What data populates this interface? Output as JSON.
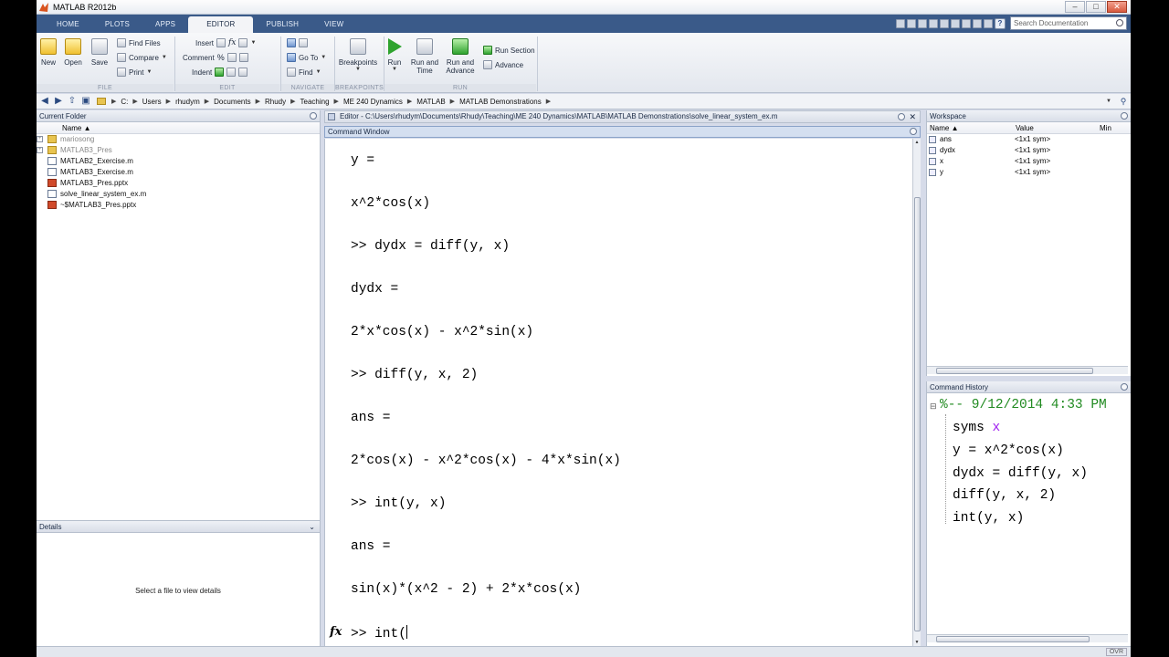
{
  "window": {
    "title": "MATLAB R2012b"
  },
  "tabs": [
    "HOME",
    "PLOTS",
    "APPS",
    "EDITOR",
    "PUBLISH",
    "VIEW"
  ],
  "active_tab": "EDITOR",
  "search": {
    "placeholder": "Search Documentation"
  },
  "ribbon": {
    "file": {
      "new": "New",
      "open": "Open",
      "save": "Save",
      "find_files": "Find Files",
      "compare": "Compare",
      "print": "Print",
      "group": "FILE"
    },
    "edit": {
      "insert": "Insert",
      "comment": "Comment",
      "indent": "Indent",
      "group": "EDIT"
    },
    "navigate": {
      "goto": "Go To",
      "find": "Find",
      "group": "NAVIGATE"
    },
    "breakpoints": {
      "label": "Breakpoints",
      "group": "BREAKPOINTS"
    },
    "run": {
      "run": "Run",
      "run_and_time_1": "Run and",
      "run_and_time_2": "Time",
      "run_and_advance_1": "Run and",
      "run_and_advance_2": "Advance",
      "run_section": "Run Section",
      "advance": "Advance",
      "group": "RUN"
    }
  },
  "address": {
    "crumbs": [
      "C:",
      "Users",
      "rhudym",
      "Documents",
      "Rhudy",
      "Teaching",
      "ME 240 Dynamics",
      "MATLAB",
      "MATLAB Demonstrations"
    ]
  },
  "current_folder": {
    "title": "Current Folder",
    "column": "Name ▲",
    "items": [
      {
        "name": "mariosong",
        "kind": "folder"
      },
      {
        "name": "MATLAB3_Pres",
        "kind": "folder"
      },
      {
        "name": "MATLAB2_Exercise.m",
        "kind": "m"
      },
      {
        "name": "MATLAB3_Exercise.m",
        "kind": "m"
      },
      {
        "name": "MATLAB3_Pres.pptx",
        "kind": "ppt"
      },
      {
        "name": "solve_linear_system_ex.m",
        "kind": "m"
      },
      {
        "name": "~$MATLAB3_Pres.pptx",
        "kind": "ppt"
      }
    ]
  },
  "details": {
    "title": "Details",
    "message": "Select a file to view details"
  },
  "editor": {
    "path": "Editor - C:\\Users\\rhudym\\Documents\\Rhudy\\Teaching\\ME 240 Dynamics\\MATLAB\\MATLAB Demonstrations\\solve_linear_system_ex.m"
  },
  "command_window": {
    "title": "Command Window",
    "lines": [
      "y =",
      "x^2*cos(x)",
      ">> dydx = diff(y, x)",
      "dydx =",
      "2*x*cos(x) - x^2*sin(x)",
      ">> diff(y, x, 2)",
      "ans =",
      "2*cos(x) - x^2*cos(x) - 4*x*sin(x)",
      ">> int(y, x)",
      "ans =",
      "sin(x)*(x^2 - 2) + 2*x*cos(x)"
    ],
    "prompt_input": ">> int(",
    "fx": "fx"
  },
  "workspace": {
    "title": "Workspace",
    "columns": [
      "Name ▲",
      "Value",
      "Min"
    ],
    "rows": [
      {
        "name": "ans",
        "value": "<1x1 sym>"
      },
      {
        "name": "dydx",
        "value": "<1x1 sym>"
      },
      {
        "name": "x",
        "value": "<1x1 sym>"
      },
      {
        "name": "y",
        "value": "<1x1 sym>"
      }
    ]
  },
  "command_history": {
    "title": "Command History",
    "session": "%-- 9/12/2014 4:33 PM",
    "cmd_syms": "syms",
    "cmd_syms_arg": "x",
    "entries": [
      "y = x^2*cos(x)",
      "dydx = diff(y, x)",
      "diff(y, x, 2)",
      "int(y, x)"
    ]
  },
  "status": {
    "ovr": "OVR"
  },
  "colors": {
    "tab_bar": "#3a5a89",
    "comment_green": "#228b22",
    "keyword_purple": "#a020f0"
  }
}
